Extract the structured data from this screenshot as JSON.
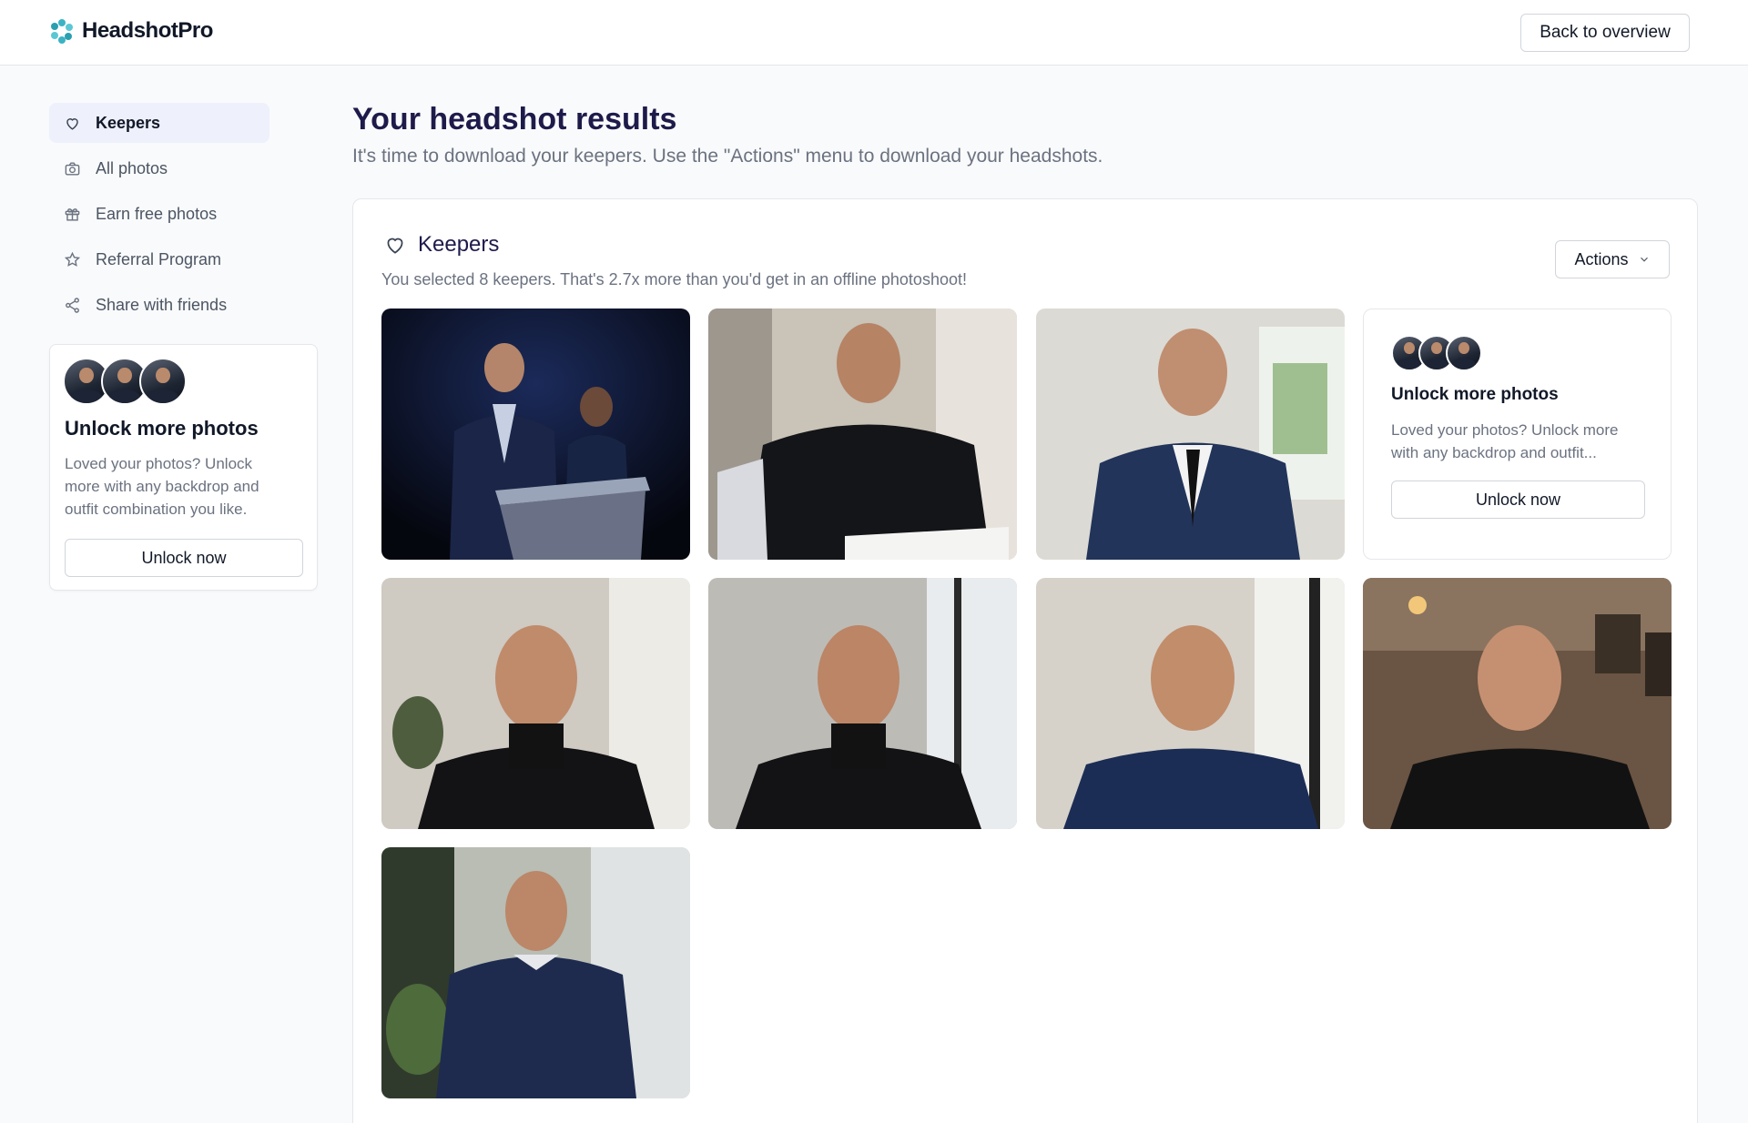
{
  "header": {
    "brand": "HeadshotPro",
    "back_label": "Back to overview"
  },
  "sidebar": {
    "items": [
      {
        "label": "Keepers",
        "icon": "heart-icon",
        "active": true
      },
      {
        "label": "All photos",
        "icon": "camera-icon",
        "active": false
      },
      {
        "label": "Earn free photos",
        "icon": "gift-icon",
        "active": false
      },
      {
        "label": "Referral Program",
        "icon": "star-icon",
        "active": false
      },
      {
        "label": "Share with friends",
        "icon": "share-icon",
        "active": false
      }
    ],
    "promo": {
      "title": "Unlock more photos",
      "text_lines": [
        "Loved your photos? Unlock",
        "more with any backdrop and",
        "outfit combination you like."
      ],
      "button": "Unlock now"
    }
  },
  "main": {
    "title": "Your headshot results",
    "subtitle": "It's time to download your keepers. Use the \"Actions\" menu to download your headshots."
  },
  "panel": {
    "title": "Keepers",
    "subtitle": "You selected 8 keepers. That's 2.7x more than you'd get in an offline photoshoot!",
    "actions_label": "Actions",
    "photos": [
      {
        "name": "photo-1",
        "scene": "stage-podium"
      },
      {
        "name": "photo-2",
        "scene": "desk-writing"
      },
      {
        "name": "photo-3",
        "scene": "office-suit"
      },
      {
        "name": "photo-4",
        "scene": "turtleneck-office"
      },
      {
        "name": "photo-5",
        "scene": "turtleneck-window"
      },
      {
        "name": "photo-6",
        "scene": "navy-sweater-bright"
      },
      {
        "name": "photo-7",
        "scene": "black-tee-cafe"
      },
      {
        "name": "photo-8",
        "scene": "navy-sweater-standing"
      }
    ],
    "promo": {
      "title": "Unlock more photos",
      "text_lines": [
        "Loved your photos? Unlock more",
        "with any backdrop and outfit..."
      ],
      "button": "Unlock now"
    }
  },
  "colors": {
    "accent": "#1e1b4b",
    "active_nav": "#eef0fc",
    "logo_teal": "#3bb3c3"
  }
}
